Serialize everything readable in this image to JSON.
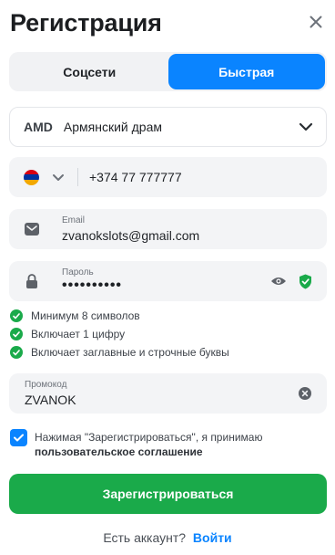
{
  "header": {
    "title": "Регистрация"
  },
  "tabs": [
    {
      "label": "Соцсети",
      "active": false
    },
    {
      "label": "Быстрая",
      "active": true
    }
  ],
  "currency": {
    "code": "AMD",
    "name": "Армянский драм"
  },
  "phone": {
    "value": "+374 77 777777",
    "flag": "armenia-flag-icon"
  },
  "email": {
    "label": "Email",
    "value": "zvanokslots@gmail.com"
  },
  "password": {
    "label": "Пароль",
    "value": "••••••••••"
  },
  "rules": [
    {
      "text": "Минимум 8 символов"
    },
    {
      "text": "Включает 1 цифру"
    },
    {
      "text": "Включает заглавные и строчные буквы"
    }
  ],
  "promo": {
    "label": "Промокод",
    "value": "ZVANOK"
  },
  "consent": {
    "text": "Нажимая \"Зарегистрироваться\", я принимаю",
    "link": "пользовательское соглашение",
    "checked": true
  },
  "submit": {
    "label": "Зарегистрироваться"
  },
  "login": {
    "prompt": "Есть аккаунт?",
    "link": "Войти"
  },
  "colors": {
    "accent": "#0a84ff",
    "success": "#1aaa4a",
    "field_bg": "#f3f4f6"
  }
}
